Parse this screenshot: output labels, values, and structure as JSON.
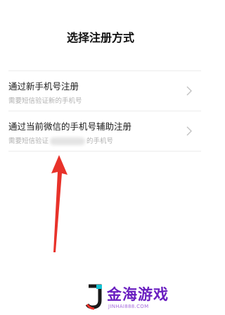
{
  "header": {
    "title": "选择注册方式"
  },
  "options": [
    {
      "label": "通过新手机号注册",
      "desc": "需要短信验证新的手机号"
    },
    {
      "label": "通过当前微信的手机号辅助注册",
      "desc_prefix": "需要短信验证",
      "desc_suffix": "的手机号"
    }
  ],
  "colors": {
    "arrow": "#e8322a",
    "watermark": "#6a1fc0",
    "divider": "#ececec",
    "desc": "#b2b2b2"
  },
  "icons": {
    "chevron": "chevron-right-icon",
    "arrow": "red-annotation-arrow"
  },
  "watermark": {
    "text": "金海游戏",
    "sub": "JINHAI888.COM"
  }
}
